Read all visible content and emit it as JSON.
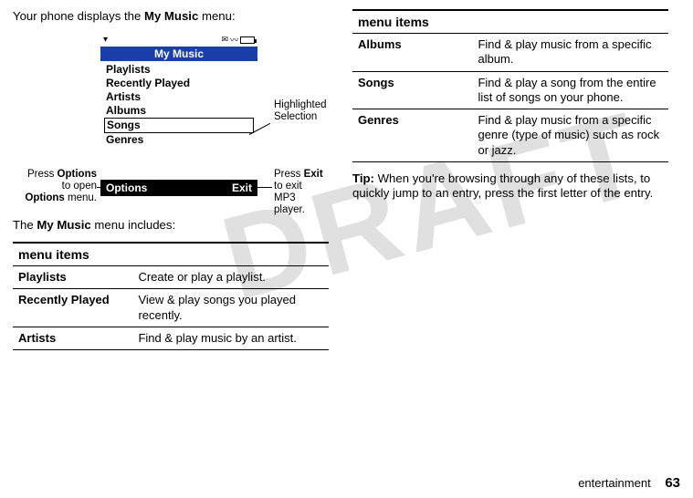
{
  "left": {
    "intro_pre": "Your phone displays the ",
    "intro_bold": "My Music",
    "intro_post": " menu:",
    "includes_pre": "The ",
    "includes_bold": "My Music",
    "includes_post": " menu includes:"
  },
  "phone": {
    "title": "My Music",
    "items": [
      "Playlists",
      "Recently Played",
      "Artists",
      "Albums",
      "Songs",
      "Genres"
    ],
    "soft_left": "Options",
    "soft_right": "Exit"
  },
  "callouts": {
    "hs": "Highlighted\nSelection",
    "exit_pre": "Press ",
    "exit_bold": "Exit",
    "exit_post": "\nto exit\nMP3 player.",
    "opt_pre": "Press ",
    "opt_bold": "Options",
    "opt_mid": "\nto open\n",
    "opt_bold2": "Options",
    "opt_post": " menu."
  },
  "table1": {
    "header": "menu items",
    "rows": [
      {
        "k": "Playlists",
        "v": "Create or play a playlist."
      },
      {
        "k": "Recently Played",
        "v": "View & play songs you played recently."
      },
      {
        "k": "Artists",
        "v": "Find & play music by an artist."
      }
    ]
  },
  "table2": {
    "header": "menu items",
    "rows": [
      {
        "k": "Albums",
        "v": "Find & play music from a specific album."
      },
      {
        "k": "Songs",
        "v": "Find & play a song from the entire list of songs on your phone."
      },
      {
        "k": "Genres",
        "v": "Find & play music from a specific genre (type of music) such as rock or jazz."
      }
    ]
  },
  "tip": {
    "label": "Tip:",
    "text": " When you're browsing through any of these lists, to quickly jump to an entry, press the first letter of the entry."
  },
  "footer": {
    "section": "entertainment",
    "page": "63"
  },
  "watermark": "DRAFT"
}
